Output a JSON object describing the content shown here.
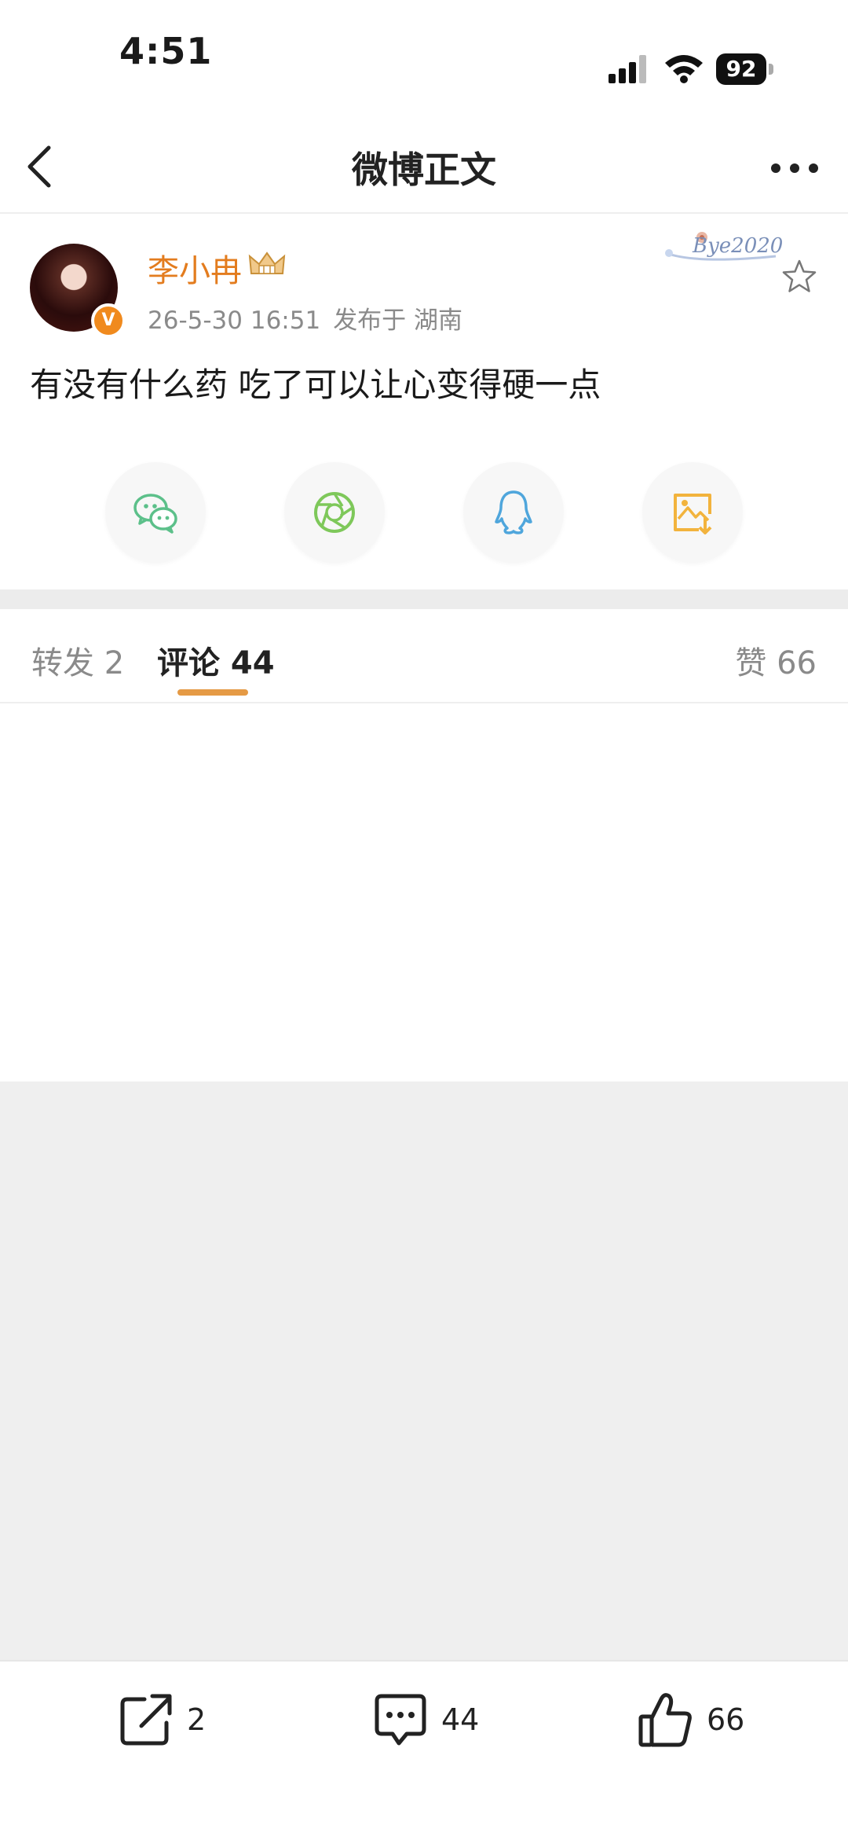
{
  "status_bar": {
    "time": "4:51",
    "battery": "92"
  },
  "nav": {
    "title": "微博正文"
  },
  "post": {
    "author": "李小冉",
    "timestamp": "26-5-30 16:51",
    "location": "发布于 湖南",
    "sticker_text": "Bye2020",
    "avatar_badge": "V",
    "content": "有没有什么药 吃了可以让心变得硬一点"
  },
  "share_buttons": [
    {
      "icon": "wechat-icon",
      "color": "#5cc08a"
    },
    {
      "icon": "moments-icon",
      "color": "#7ec85a"
    },
    {
      "icon": "qq-icon",
      "color": "#4fa6dc"
    },
    {
      "icon": "save-image-icon",
      "color": "#f2b33d"
    }
  ],
  "tabs": {
    "repost": "转发 2",
    "comments": "评论 44",
    "likes": "赞 66"
  },
  "toolbar": {
    "repost_count": "2",
    "comment_count": "44",
    "like_count": "66"
  },
  "colors": {
    "accent_orange": "#e37c1e",
    "tab_underline": "#e59a45",
    "divider_grey": "#efefef"
  }
}
